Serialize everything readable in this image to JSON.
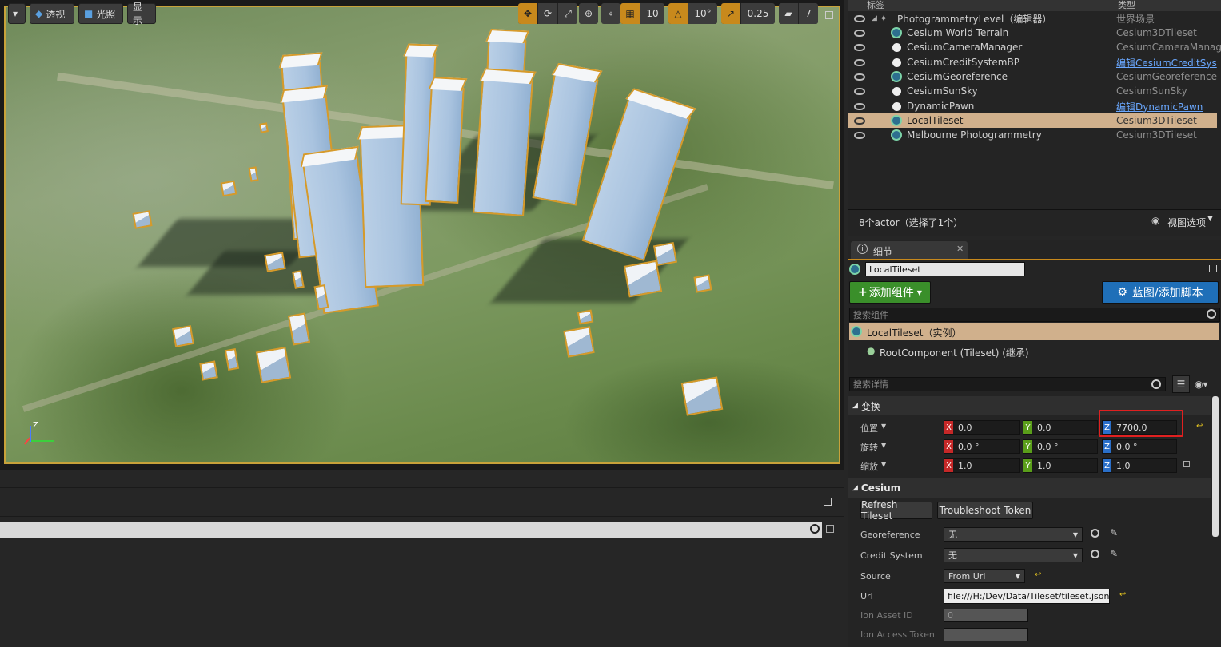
{
  "viewport": {
    "toolbar": {
      "perspective": "透视",
      "lighting": "光照",
      "show": "显示",
      "grid_snap": "10",
      "rot_snap": "10°",
      "scale_snap": "0.25",
      "cam_speed": "7"
    },
    "axes_label": "Z"
  },
  "outliner": {
    "col_label": "标签",
    "col_type": "类型",
    "rows": [
      {
        "name": "PhotogrammetryLevel（编辑器）",
        "type": "世界场景"
      },
      {
        "name": "Cesium World Terrain",
        "type": "Cesium3DTileset"
      },
      {
        "name": "CesiumCameraManager",
        "type": "CesiumCameraManage"
      },
      {
        "name": "CesiumCreditSystemBP",
        "type": "编辑CesiumCreditSys"
      },
      {
        "name": "CesiumGeoreference",
        "type": "CesiumGeoreference"
      },
      {
        "name": "CesiumSunSky",
        "type": "CesiumSunSky"
      },
      {
        "name": "DynamicPawn",
        "type": "编辑DynamicPawn"
      },
      {
        "name": "LocalTileset",
        "type": "Cesium3DTileset"
      },
      {
        "name": "Melbourne Photogrammetry",
        "type": "Cesium3DTileset"
      }
    ],
    "status": "8个actor（选择了1个）",
    "view_options": "视图选项"
  },
  "details": {
    "tab": "细节",
    "actor_name": "LocalTileset",
    "add_component": "添加组件",
    "blueprint": "蓝图/添加脚本",
    "search_components": "搜索组件",
    "instance_row": "LocalTileset（实例）",
    "root_component": "RootComponent (Tileset) (继承)",
    "search_details": "搜索详情",
    "transform_section": "变换",
    "location_label": "位置",
    "rotation_label": "旋转",
    "scale_label": "缩放",
    "location": {
      "x": "0.0",
      "y": "0.0",
      "z": "7700.0"
    },
    "rotation": {
      "x": "0.0 °",
      "y": "0.0 °",
      "z": "0.0 °"
    },
    "scale": {
      "x": "1.0",
      "y": "1.0",
      "z": "1.0"
    },
    "cesium_section": "Cesium",
    "refresh_tileset": "Refresh Tileset",
    "troubleshoot_token": "Troubleshoot Token",
    "georeference_label": "Georeference",
    "georeference_value": "无",
    "credit_system_label": "Credit System",
    "credit_system_value": "无",
    "source_label": "Source",
    "source_value": "From Url",
    "url_label": "Url",
    "url_value": "file:///H:/Dev/Data/Tileset/tileset.json",
    "ion_asset_id_label": "Ion Asset ID",
    "ion_asset_id_value": "0",
    "ion_access_token_label": "Ion Access Token"
  },
  "colors": {
    "selection": "#d0b08c",
    "highlight_red": "#e02020",
    "add_component_green": "#3a8f2a",
    "blueprint_blue": "#1f6fb8"
  }
}
